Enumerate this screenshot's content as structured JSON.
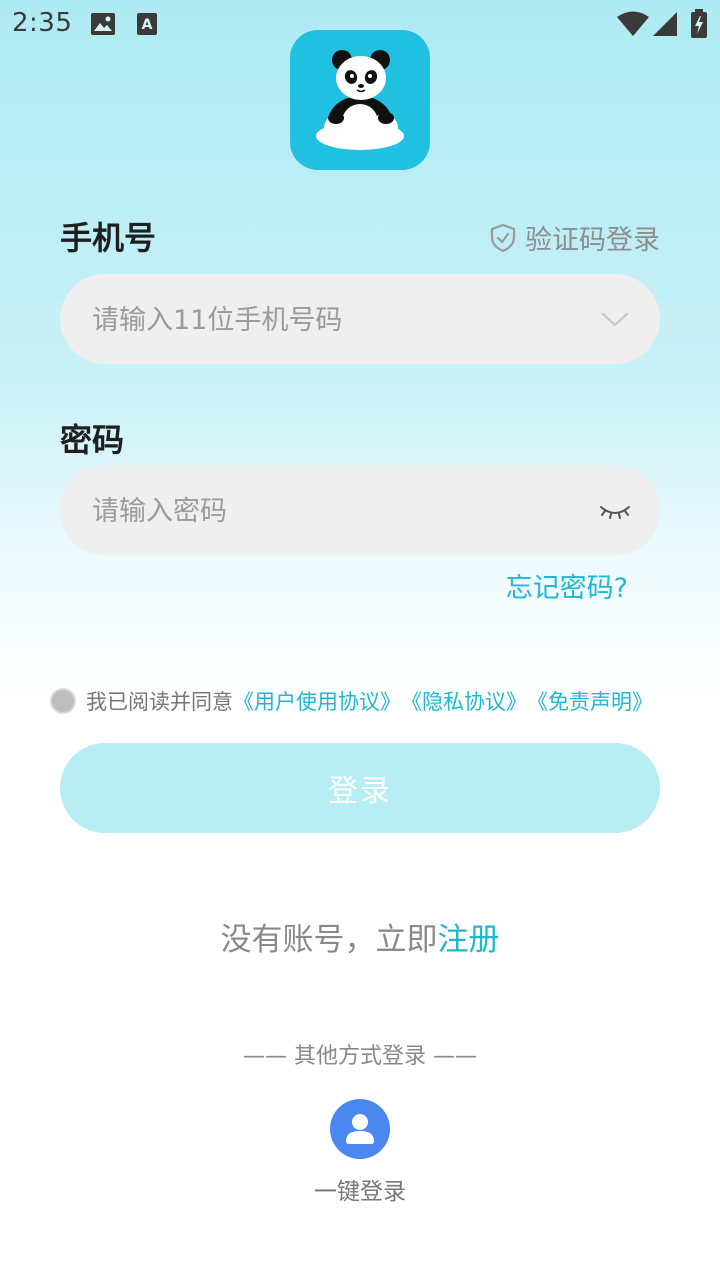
{
  "status_bar": {
    "time": "2:35"
  },
  "phone": {
    "label": "手机号",
    "placeholder": "请输入11位手机号码"
  },
  "sms_login": {
    "label": "验证码登录",
    "icon": "shield-check-icon"
  },
  "password": {
    "label": "密码",
    "placeholder": "请输入密码",
    "toggle_icon": "eye-closed-icon"
  },
  "forgot_password": "忘记密码?",
  "agreement": {
    "text": "我已阅读并同意",
    "links": [
      "《用户使用协议》",
      "《隐私协议》",
      "《免责声明》"
    ]
  },
  "login_button": "登录",
  "register": {
    "text": "没有账号，立即",
    "link": "注册"
  },
  "other_login": {
    "title": "—— 其他方式登录 ——",
    "one_key_label": "一键登录",
    "icon": "user-icon"
  },
  "colors": {
    "accent": "#1eb8d3",
    "login_button_disabled": "#b7eef3",
    "one_key_icon_bg": "#4a87ef",
    "logo_bg": "#1fc0e0"
  }
}
